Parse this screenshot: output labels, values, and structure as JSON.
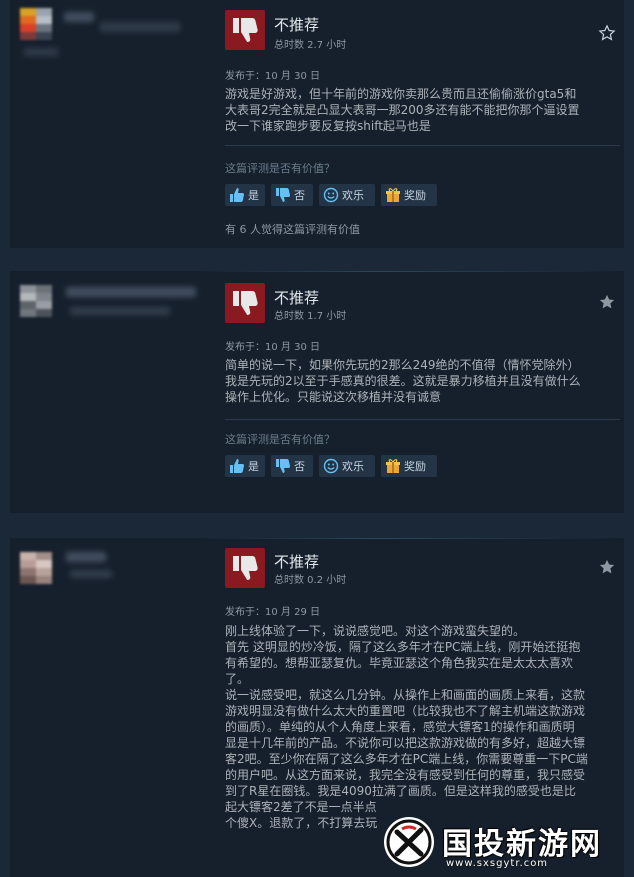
{
  "reviews": [
    {
      "verdict": "不推荐",
      "hours": "总时数 2.7 小时",
      "posted": "发布于：10 月 30 日",
      "content": [
        "游戏是好游戏，但十年前的游戏你卖那么贵而且还偷偷涨价gta5和",
        "大表哥2完全就是凸显大表哥一那200多还有能不能把你那个逼设置",
        "改一下谁家跑步要反复按shift起马也是"
      ],
      "helpful_question": "这篇评测是否有价值？",
      "buttons": {
        "yes": "是",
        "no": "否",
        "funny": "欢乐",
        "award": "奖励"
      },
      "helpful_count": "有 6 人觉得这篇评测有价值",
      "star_color": "#c6d4df"
    },
    {
      "verdict": "不推荐",
      "hours": "总时数 1.7 小时",
      "posted": "发布于：10 月 30 日",
      "content": [
        "简单的说一下，如果你先玩的2那么249绝的不值得（情怀党除外）",
        "我是先玩的2以至于手感真的很差。这就是暴力移植并且没有做什么",
        "操作上优化。只能说这次移植并没有诚意"
      ],
      "helpful_question": "这篇评测是否有价值？",
      "buttons": {
        "yes": "是",
        "no": "否",
        "funny": "欢乐",
        "award": "奖励"
      },
      "star_color": "#8f98a0"
    },
    {
      "verdict": "不推荐",
      "hours": "总时数 0.2 小时",
      "posted": "发布于：10 月 29 日",
      "content": [
        "刚上线体验了一下，说说感觉吧。对这个游戏蛮失望的。",
        "首先 这明显的炒冷饭，隔了这么多年才在PC端上线，刚开始还挺抱",
        "有希望的。想帮亚瑟复仇。毕竟亚瑟这个角色我实在是太太太喜欢",
        "了。",
        "说一说感受吧，就这么几分钟。从操作上和画面的画质上来看，这款",
        "游戏明显没有做什么太大的重置吧（比较我也不了解主机端这款游戏",
        "的画质）。单纯的从个人角度上来看，感觉大镖客1的操作和画质明",
        "显是十几年前的产品。不说你可以把这款游戏做的有多好，超越大镖",
        "客2吧。至少你在隔了这么多年才在PC端上线，你需要尊重一下PC端",
        "的用户吧。从这方面来说，我完全没有感受到任何的尊重，我只感受",
        "到了R星在圈钱。我是4090拉满了画质。但是这样我的感受也是比",
        "起大镖客2差了不是一点半点",
        "个傻X。退款了，不打算去玩"
      ],
      "star_color": "#8f98a0"
    }
  ],
  "watermark": {
    "text": "国投新游网",
    "url": "www.sxsgytr.com"
  },
  "colors": {
    "background": "#1b2838",
    "card": "#16202d",
    "thumb_down_bg": "#8a1a1f",
    "button_bg": "#223446"
  }
}
